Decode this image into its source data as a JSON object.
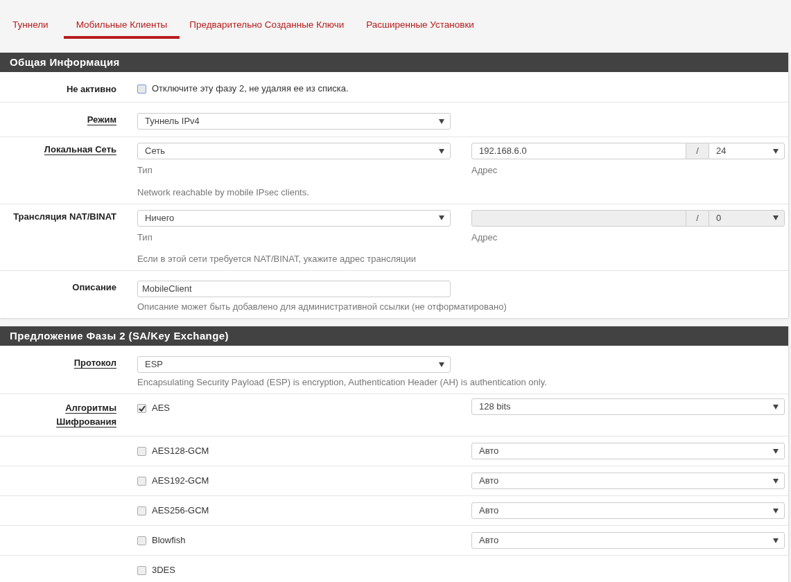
{
  "tabs": [
    {
      "label": "Туннели",
      "selected": false
    },
    {
      "label": "Мобильные Клиенты",
      "selected": true
    },
    {
      "label": "Предварительно Созданные Ключи",
      "selected": false
    },
    {
      "label": "Расширенные Установки",
      "selected": false
    }
  ],
  "sections": [
    {
      "title": "Общая Информация",
      "rows": [
        {
          "kind": "checkbox",
          "label": "Не активно",
          "link": false,
          "checked": false,
          "text": "Отключите эту фазу 2, не удаляя ее из списка."
        },
        {
          "kind": "select",
          "label": "Режим",
          "link": true,
          "value": "Туннель IPv4"
        },
        {
          "kind": "network",
          "label": "Локальная Сеть",
          "link": true,
          "type_value": "Сеть",
          "type_caption": "Тип",
          "address_value": "192.168.6.0",
          "disabled": false,
          "separator": "/",
          "mask": "24",
          "address_caption": "Адрес",
          "help": "Network reachable by mobile IPsec clients."
        },
        {
          "kind": "network",
          "label": "Трансляция NAT/BINAT",
          "link": false,
          "type_value": "Ничего",
          "type_caption": "Тип",
          "disabled": true,
          "separator": "/",
          "mask": "0",
          "address_caption": "Адрес",
          "help": "Если в этой сети требуется NAT/BINAT, укажите адрес трансляции"
        },
        {
          "kind": "text",
          "label": "Описание",
          "link": false,
          "value": "MobileClient",
          "help": "Описание может быть добавлено для административной ссылки (не отформатировано)"
        }
      ]
    },
    {
      "title": "Предложение Фазы 2 (SA/Key Exchange)",
      "rows": [
        {
          "kind": "select",
          "label": "Протокол",
          "link": true,
          "value": "ESP",
          "help": "Encapsulating Security Payload (ESP) is encryption, Authentication Header (AH) is authentication only."
        },
        {
          "kind": "algorithm",
          "label": "Алгоритмы Шифрования",
          "link": true,
          "checked": true,
          "name": "AES",
          "key_length": "128 bits"
        },
        {
          "kind": "algorithm",
          "checked": false,
          "name": "AES128-GCM",
          "key_length": "Авто"
        },
        {
          "kind": "algorithm",
          "checked": false,
          "name": "AES192-GCM",
          "key_length": "Авто"
        },
        {
          "kind": "algorithm",
          "checked": false,
          "name": "AES256-GCM",
          "key_length": "Авто"
        },
        {
          "kind": "algorithm",
          "checked": false,
          "name": "Blowfish",
          "key_length": "Авто"
        },
        {
          "kind": "algorithm",
          "checked": false,
          "name": "3DES"
        }
      ]
    }
  ]
}
